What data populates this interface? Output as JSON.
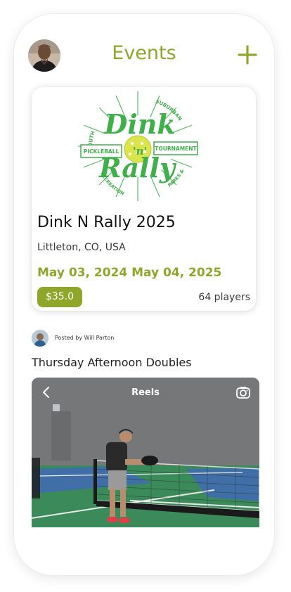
{
  "header": {
    "title": "Events",
    "add_icon": "plus-icon",
    "avatar_icon": "user-avatar"
  },
  "event": {
    "logo": {
      "title_line1": "Dink",
      "title_mid": "'n'",
      "title_line2": "Rally",
      "ribbon_left": "PICKLEBALL",
      "ribbon_right": "TOURNAMENT",
      "arc_left_top": "SOUTH",
      "arc_right_top": "SUBURBAN",
      "arc_left_bottom": "RECREATION",
      "arc_right_bottom": "PARKS &"
    },
    "name": "Dink N Rally 2025",
    "location": "Littleton, CO, USA",
    "dates": "May 03, 2024 May 04, 2025",
    "price": "$35.0",
    "players": "64 players"
  },
  "post": {
    "posted_by": "Posted by Will Parton",
    "title": "Thursday Afternoon Doubles",
    "video_label": "Reels",
    "back_icon": "chevron-left-icon",
    "camera_icon": "camera-icon"
  },
  "colors": {
    "accent": "#8ea72b",
    "logo_green": "#3faf4a",
    "ball_yellow": "#d9e54a"
  }
}
